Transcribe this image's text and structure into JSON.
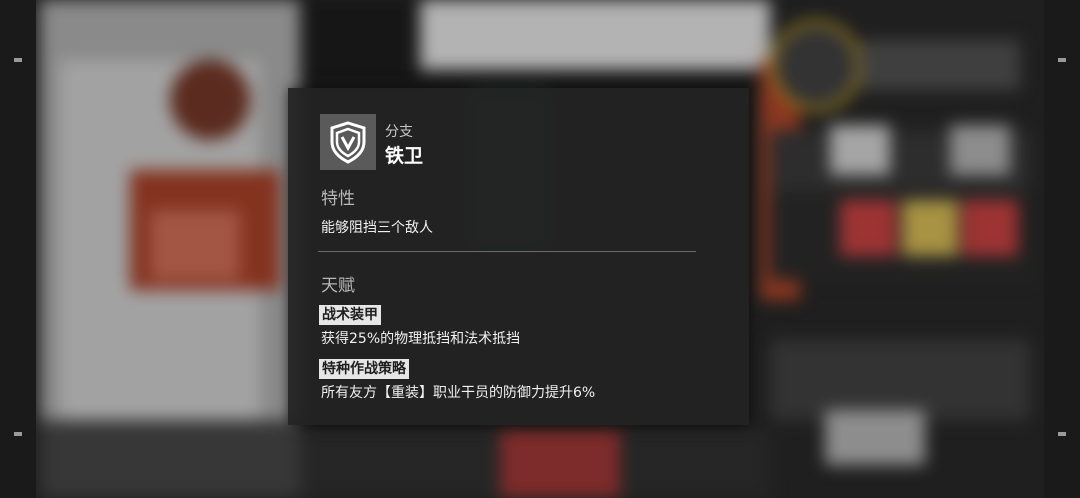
{
  "branch": {
    "icon": "shield-branch-icon",
    "label": "分支",
    "name": "铁卫"
  },
  "trait": {
    "title": "特性",
    "description": "能够阻挡三个敌人"
  },
  "talent": {
    "title": "天赋",
    "items": [
      {
        "name": "战术装甲",
        "description": "获得25%的物理抵挡和法术抵挡"
      },
      {
        "name": "特种作战策略",
        "description": "所有友方【重装】职业干员的防御力提升6%"
      }
    ]
  },
  "colors": {
    "panel_bg": "#222222",
    "tag_bg": "#e6e6e6",
    "accent_red": "#c0392b",
    "accent_yellow": "#c9a227"
  }
}
